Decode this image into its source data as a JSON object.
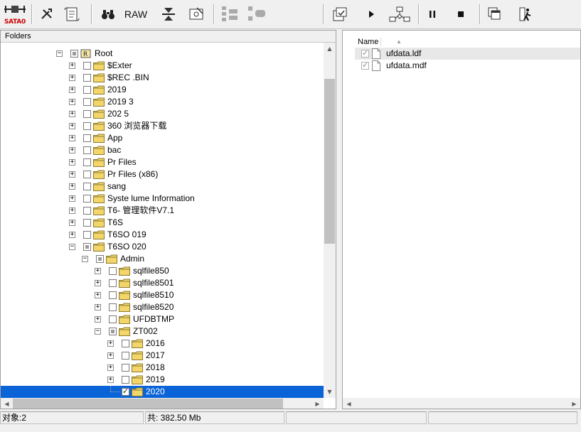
{
  "toolbar": {
    "sata_label": "SATA0",
    "raw_label": "RAW",
    "icons": [
      "drive-icon",
      "tools-icon",
      "scroll-icon",
      "binoculars-icon",
      "raw-icon",
      "filter-icon",
      "save-disk-icon",
      "tree-expand-icon",
      "tree-collapse-icon",
      "export-icon",
      "play-icon",
      "flow-icon",
      "pause-icon",
      "stop-icon",
      "windows-icon",
      "exit-icon"
    ]
  },
  "left_panel": {
    "header": "Folders",
    "rows": [
      {
        "label": "Root",
        "level": 0,
        "expander": "-",
        "check": "partial",
        "icon": "root-drive"
      },
      {
        "label": "$Exter",
        "level": 1,
        "expander": "+",
        "check": "none",
        "icon": "folder"
      },
      {
        "label": "$REC      .BIN",
        "level": 1,
        "expander": "+",
        "check": "none",
        "icon": "folder"
      },
      {
        "label": "2019",
        "level": 1,
        "expander": "+",
        "check": "none",
        "icon": "folder"
      },
      {
        "label": "2019      3",
        "level": 1,
        "expander": "+",
        "check": "none",
        "icon": "folder"
      },
      {
        "label": "202       5",
        "level": 1,
        "expander": "+",
        "check": "none",
        "icon": "folder"
      },
      {
        "label": "360      浏览器下载",
        "level": 1,
        "expander": "+",
        "check": "none",
        "icon": "folder"
      },
      {
        "label": "App",
        "level": 1,
        "expander": "+",
        "check": "none",
        "icon": "folder"
      },
      {
        "label": "bac",
        "level": 1,
        "expander": "+",
        "check": "none",
        "icon": "folder"
      },
      {
        "label": "Pr        Files",
        "level": 1,
        "expander": "+",
        "check": "none",
        "icon": "folder"
      },
      {
        "label": "Pr        Files (x86)",
        "level": 1,
        "expander": "+",
        "check": "none",
        "icon": "folder"
      },
      {
        "label": "sang",
        "level": 1,
        "expander": "+",
        "check": "none",
        "icon": "folder"
      },
      {
        "label": "Syste     lume Information",
        "level": 1,
        "expander": "+",
        "check": "none",
        "icon": "folder"
      },
      {
        "label": "T6-       管理软件V7.1",
        "level": 1,
        "expander": "+",
        "check": "none",
        "icon": "folder"
      },
      {
        "label": "T6S",
        "level": 1,
        "expander": "+",
        "check": "none",
        "icon": "folder"
      },
      {
        "label": "T6SO      019",
        "level": 1,
        "expander": "+",
        "check": "none",
        "icon": "folder"
      },
      {
        "label": "T6SO      020",
        "level": 1,
        "expander": "-",
        "check": "partial",
        "icon": "folder"
      },
      {
        "label": "Admin",
        "level": 2,
        "expander": "-",
        "check": "partial",
        "icon": "folder"
      },
      {
        "label": "sqlfile850",
        "level": 3,
        "expander": "+",
        "check": "none",
        "icon": "folder"
      },
      {
        "label": "sqlfile8501",
        "level": 3,
        "expander": "+",
        "check": "none",
        "icon": "folder"
      },
      {
        "label": "sqlfile8510",
        "level": 3,
        "expander": "+",
        "check": "none",
        "icon": "folder"
      },
      {
        "label": "sqlfile8520",
        "level": 3,
        "expander": "+",
        "check": "none",
        "icon": "folder"
      },
      {
        "label": "UFDBTMP",
        "level": 3,
        "expander": "+",
        "check": "none",
        "icon": "folder"
      },
      {
        "label": "ZT002",
        "level": 3,
        "expander": "-",
        "check": "partial",
        "icon": "folder"
      },
      {
        "label": "2016",
        "level": 4,
        "expander": "+",
        "check": "none",
        "icon": "folder"
      },
      {
        "label": "2017",
        "level": 4,
        "expander": "+",
        "check": "none",
        "icon": "folder"
      },
      {
        "label": "2018",
        "level": 4,
        "expander": "+",
        "check": "none",
        "icon": "folder"
      },
      {
        "label": "2019",
        "level": 4,
        "expander": "+",
        "check": "none",
        "icon": "folder"
      },
      {
        "label": "2020",
        "level": 4,
        "expander": "",
        "check": "checked",
        "icon": "folder",
        "selected": true
      }
    ]
  },
  "right_panel": {
    "column_name": "Name",
    "files": [
      {
        "name": "ufdata.ldf",
        "checked": true
      },
      {
        "name": "ufdata.mdf",
        "checked": true
      }
    ]
  },
  "status": {
    "objects": "对象:2",
    "total": "共:  382.50 Mb",
    "cell3": "",
    "cell4": "",
    "cell5": ""
  },
  "colors": {
    "selection": "#0a64d8",
    "folder_yellow": "#f3d56a",
    "sata_red": "#cc0000"
  }
}
